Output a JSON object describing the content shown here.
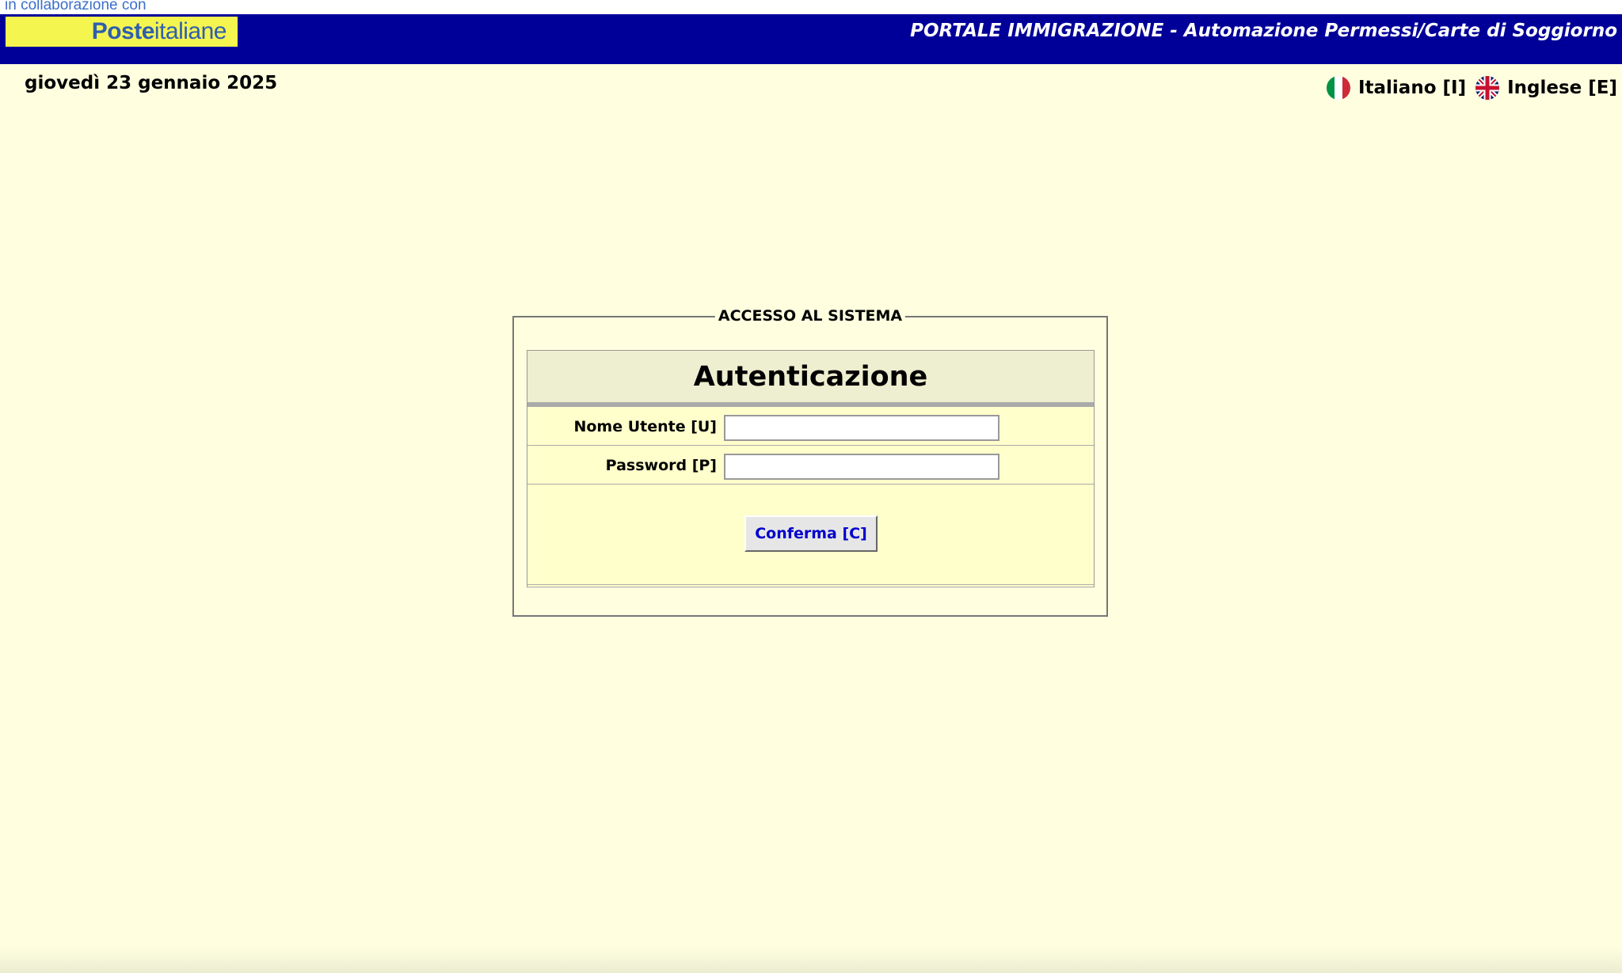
{
  "header": {
    "collab_text": "in collaborazione con",
    "logo": {
      "part_bold": "Poste",
      "part_regular": "italiane"
    },
    "portal_title": "PORTALE IMMIGRAZIONE - Automazione Permessi/Carte di Soggiorno"
  },
  "date": "giovedì 23 gennaio 2025",
  "languages": [
    {
      "label": "Italiano [I]",
      "icon": "italian-flag-icon"
    },
    {
      "label": "Inglese [E]",
      "icon": "uk-flag-icon"
    }
  ],
  "login": {
    "legend": "ACCESSO AL SISTEMA",
    "title": "Autenticazione",
    "username_label": "Nome Utente [U]",
    "username_value": "",
    "password_label": "Password [P]",
    "password_value": "",
    "confirm_label": "Conferma [C]"
  },
  "colors": {
    "header_bg": "#000099",
    "page_bg": "#ffffe0",
    "logo_bg": "#f5f550",
    "button_text": "#0000cc"
  }
}
